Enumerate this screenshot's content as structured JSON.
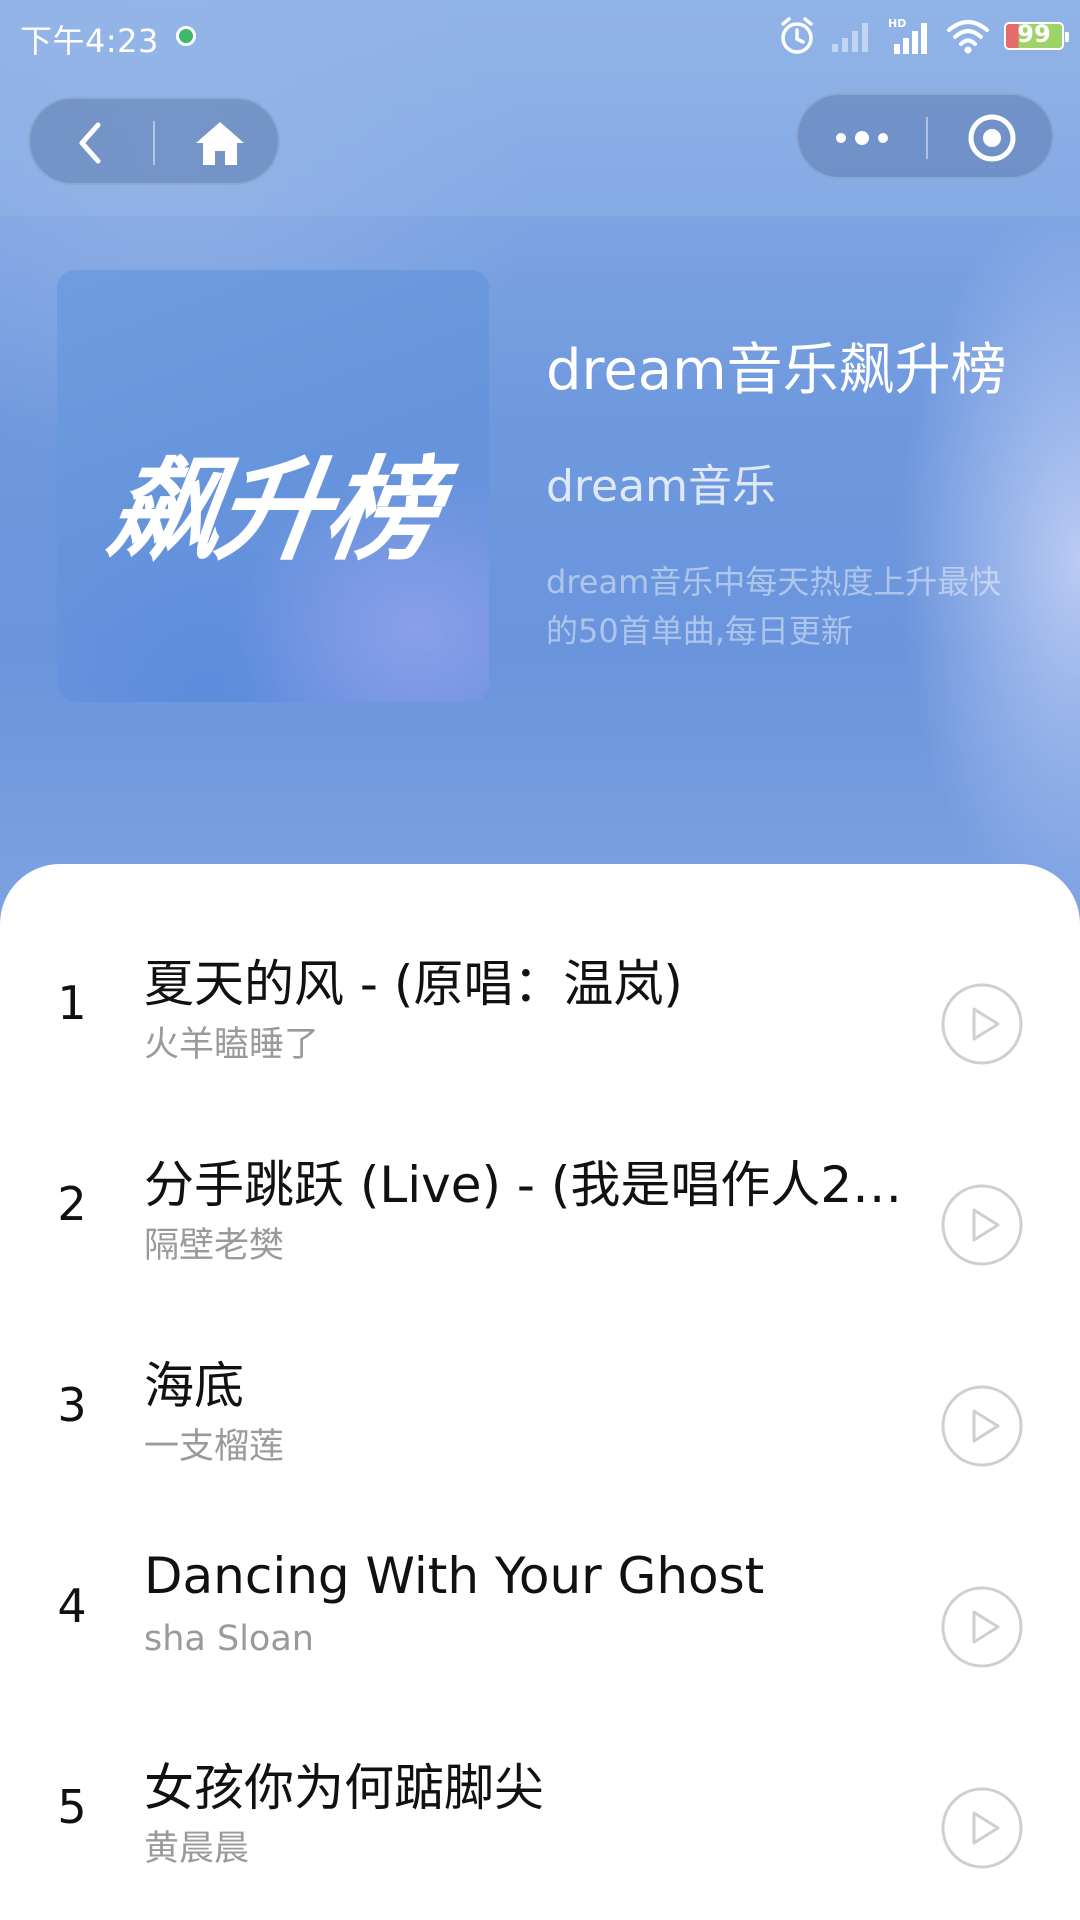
{
  "status_bar": {
    "time": "下午4:23",
    "battery": "99",
    "icons": [
      "alarm-icon",
      "signal-icon",
      "wifi-icon",
      "battery-icon"
    ]
  },
  "nav": {
    "back_icon": "chevron-left-icon",
    "home_icon": "home-icon",
    "more_icon": "more-dots-icon",
    "close_icon": "target-icon"
  },
  "playlist": {
    "cover_text": "飙升榜",
    "title": "dream音乐飙升榜",
    "creator": "dream音乐",
    "description": "dream音乐中每天热度上升最快的50首单曲,每日更新"
  },
  "songs": [
    {
      "rank": "1",
      "name": "夏天的风 - (原唱：温岚)",
      "artist": "火羊瞌睡了"
    },
    {
      "rank": "2",
      "name": "分手跳跃 (Live) - (我是唱作人2第…",
      "artist": "隔壁老樊"
    },
    {
      "rank": "3",
      "name": "海底",
      "artist": "一支榴莲"
    },
    {
      "rank": "4",
      "name": "Dancing With Your Ghost",
      "artist": "sha Sloan"
    },
    {
      "rank": "5",
      "name": "女孩你为何踮脚尖",
      "artist": "黄晨晨"
    }
  ],
  "colors": {
    "hero": "#6f99de",
    "text_primary": "#111111",
    "text_secondary": "#9a9a9a"
  }
}
